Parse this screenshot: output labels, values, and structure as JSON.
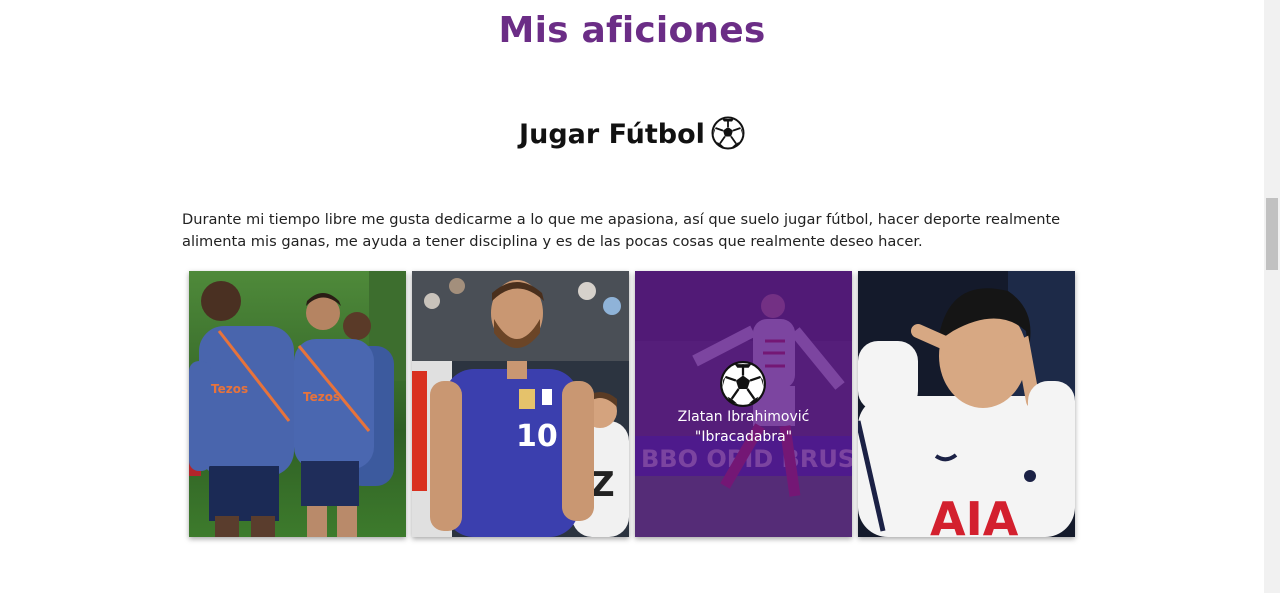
{
  "page": {
    "title": "Mis aficiones"
  },
  "section": {
    "title": "Jugar Fútbol",
    "title_icon": "soccer-ball-icon",
    "description": "Durante mi tiempo libre me gusta dedicarme a lo que me apasiona, así que suelo jugar fútbol, hacer deporte realmente alimenta mis ganas, me ayuda a tener disciplina y es de las pocas cosas que realmente deseo hacer."
  },
  "gallery": {
    "cards": [
      {
        "photo": "players-training-photo"
      },
      {
        "photo": "player-number-10-photo"
      },
      {
        "photo": "player-celebrating-photo",
        "overlay_icon": "soccer-ball-icon",
        "caption_line1": "Zlatan Ibrahimović",
        "caption_line2": "\"Ibracadabra\""
      },
      {
        "photo": "player-gesture-photo"
      }
    ]
  },
  "colors": {
    "title": "#6b2d86",
    "overlay": "#5c168c",
    "text": "#222222"
  }
}
